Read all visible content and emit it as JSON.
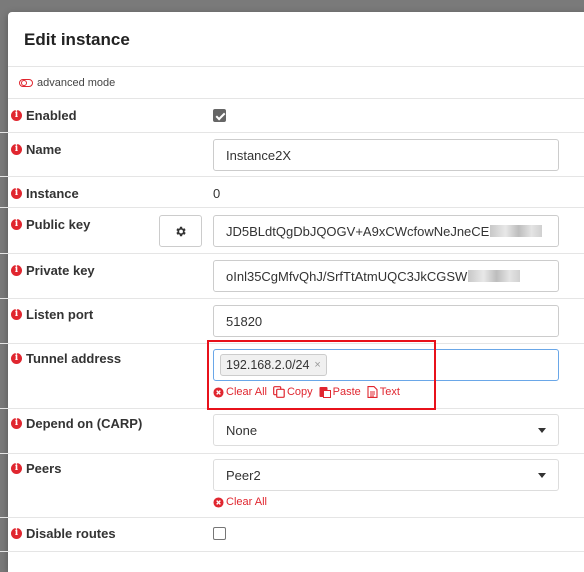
{
  "dialog": {
    "title": "Edit instance",
    "advanced_mode_label": "advanced mode"
  },
  "fields": {
    "enabled": {
      "label": "Enabled",
      "checked": true
    },
    "name": {
      "label": "Name",
      "value": "Instance2X"
    },
    "instance": {
      "label": "Instance",
      "value": "0"
    },
    "public_key": {
      "label": "Public key",
      "value": "JD5BLdtQgDbJQOGV+A9xCWcfowNeJneCE"
    },
    "private_key": {
      "label": "Private key",
      "value": "oInl35CgMfvQhJ/SrfTtAtmUQC3JkCGSW"
    },
    "listen_port": {
      "label": "Listen port",
      "value": "51820"
    },
    "tunnel_address": {
      "label": "Tunnel address",
      "tag": "192.168.2.0/24",
      "tag_remove": "×",
      "actions": {
        "clear_all": "Clear All",
        "copy": "Copy",
        "paste": "Paste",
        "text": "Text"
      }
    },
    "depend_on": {
      "label": "Depend on (CARP)",
      "selected": "None"
    },
    "peers": {
      "label": "Peers",
      "selected": "Peer2",
      "clear_all": "Clear All"
    },
    "disable_routes": {
      "label": "Disable routes",
      "checked": false
    }
  },
  "colors": {
    "accent": "#e0262f",
    "highlight": "#e8111b"
  },
  "icons": [
    "info-icon",
    "gear-icon",
    "clear-icon",
    "copy-icon",
    "paste-icon",
    "text-icon",
    "toggle-icon"
  ]
}
